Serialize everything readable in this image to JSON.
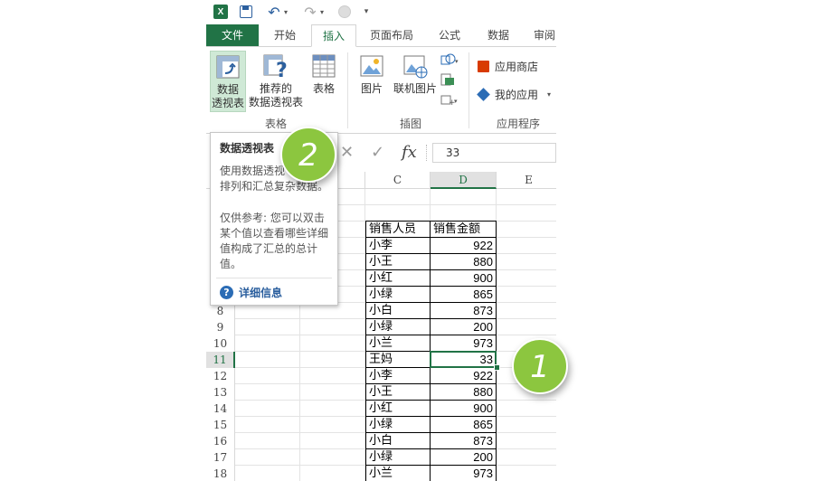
{
  "qat": {
    "logo": "X",
    "undo": "↶",
    "redo": "↷",
    "dropdown": "▾"
  },
  "tabs": [
    "文件",
    "开始",
    "插入",
    "页面布局",
    "公式",
    "数据",
    "审阅"
  ],
  "ribbon": {
    "pivot_table": [
      "数据",
      "透视表"
    ],
    "recommended_pivot": [
      "推荐的",
      "数据透视表"
    ],
    "table": "表格",
    "group_tables": "表格",
    "pictures": "图片",
    "online_pictures": "联机图片",
    "group_illustrations": "插图",
    "app_store": "应用商店",
    "my_apps": "我的应用",
    "group_apps": "应用程序"
  },
  "formula_bar": {
    "cancel": "✕",
    "enter": "✓",
    "fx": "fx",
    "value": "33"
  },
  "columns": [
    "C",
    "D",
    "E"
  ],
  "rows": [
    {
      "num": "",
      "c": "",
      "d": ""
    },
    {
      "num": "",
      "c": "",
      "d": ""
    },
    {
      "num": "",
      "c": "销售人员",
      "d": "销售金额"
    },
    {
      "num": "",
      "c": "小李",
      "d": "922"
    },
    {
      "num": "",
      "c": "小王",
      "d": "880"
    },
    {
      "num": "",
      "c": "小红",
      "d": "900"
    },
    {
      "num": "",
      "c": "小绿",
      "d": "865"
    },
    {
      "num": "8",
      "c": "小白",
      "d": "873"
    },
    {
      "num": "9",
      "c": "小绿",
      "d": "200"
    },
    {
      "num": "10",
      "c": "小兰",
      "d": "973"
    },
    {
      "num": "11",
      "c": "王妈",
      "d": "33"
    },
    {
      "num": "12",
      "c": "小李",
      "d": "922"
    },
    {
      "num": "13",
      "c": "小王",
      "d": "880"
    },
    {
      "num": "14",
      "c": "小红",
      "d": "900"
    },
    {
      "num": "15",
      "c": "小绿",
      "d": "865"
    },
    {
      "num": "16",
      "c": "小白",
      "d": "873"
    },
    {
      "num": "17",
      "c": "小绿",
      "d": "200"
    },
    {
      "num": "18",
      "c": "小兰",
      "d": "973"
    }
  ],
  "tooltip": {
    "title": "数据透视表",
    "desc1": "使用数据透视",
    "desc2": "排列和汇总复杂数据。",
    "note": [
      "仅供参考: 您可以双击",
      "某个值以查看哪些详细",
      "值构成了汇总的总计",
      "值。"
    ],
    "help": "详细信息"
  },
  "badges": {
    "one": "1",
    "two": "2"
  },
  "colors": {
    "excel_green": "#217346",
    "badge_green": "#8cc63f"
  }
}
